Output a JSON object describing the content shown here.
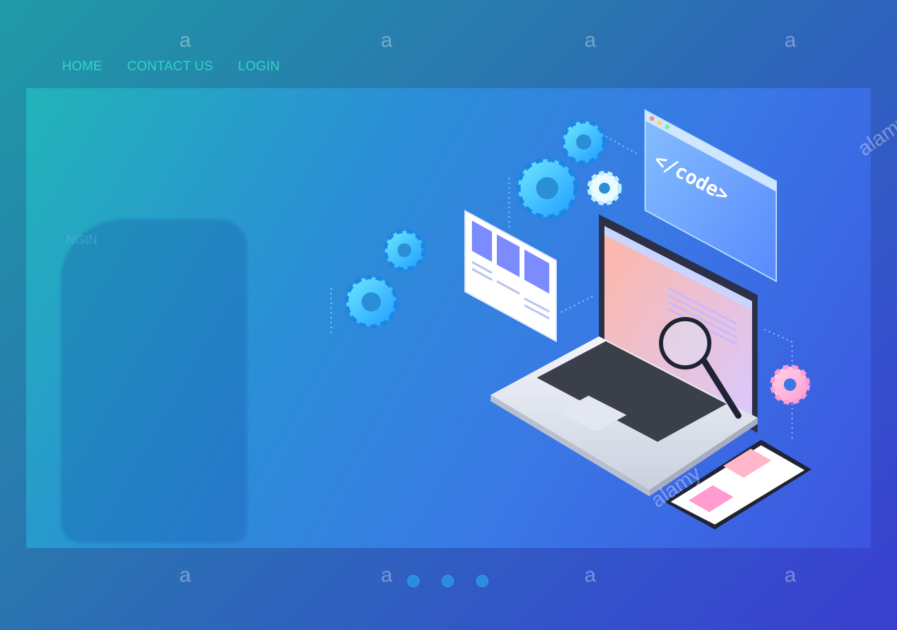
{
  "nav": {
    "items": [
      {
        "label": "HOME"
      },
      {
        "label": "CONTACT US"
      },
      {
        "label": "LOGIN"
      }
    ]
  },
  "hero": {
    "code_window_label": "</code>",
    "ghost_text": "NGIN"
  },
  "carousel": {
    "total_slides": 3
  },
  "watermark": {
    "brand": "alamy",
    "glyph": "a"
  },
  "colors": {
    "nav_text": "#2fd6c5",
    "accent": "#2a8de0"
  },
  "icons": [
    "gear-icon",
    "magnifier-icon",
    "laptop-icon",
    "tablet-icon",
    "code-window-icon"
  ]
}
